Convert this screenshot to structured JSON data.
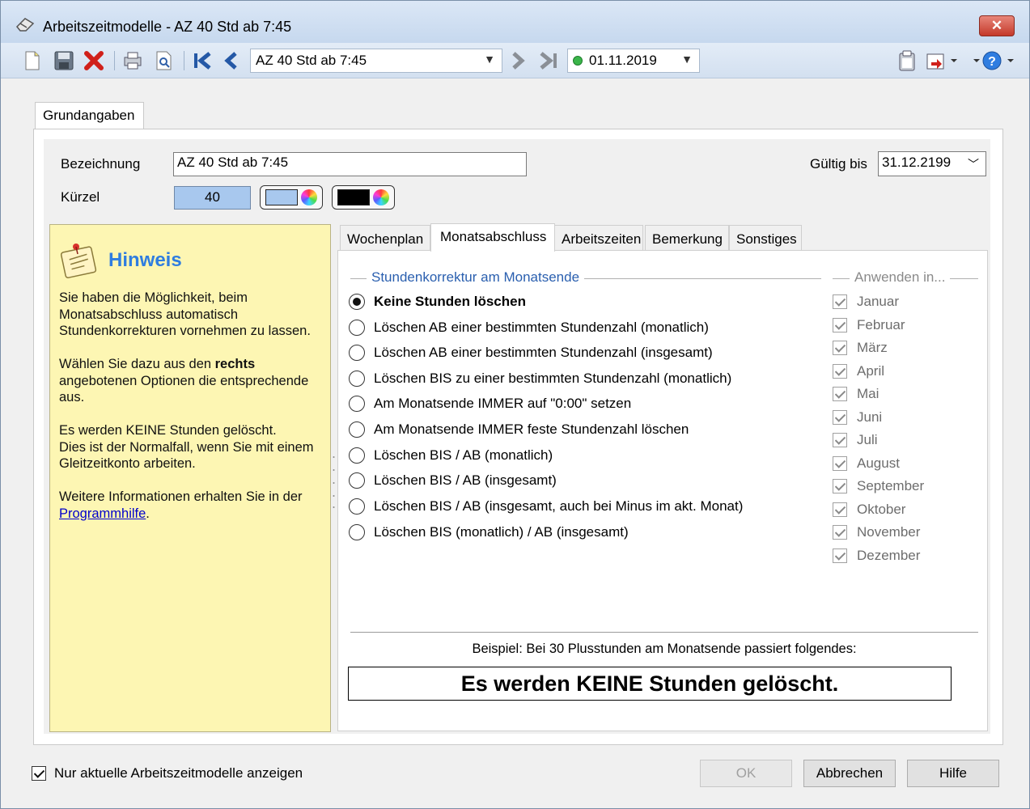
{
  "window": {
    "title": "Arbeitszeitmodelle - AZ 40 Std ab 7:45",
    "close_label": "✕"
  },
  "toolbar": {
    "model_combo_value": "AZ 40 Std ab 7:45",
    "date_combo_value": "01.11.2019",
    "icons": [
      "new-icon",
      "save-icon",
      "delete-icon",
      "print-icon",
      "print-preview-icon",
      "first-record-icon",
      "previous-record-icon",
      "next-record-icon",
      "last-record-icon",
      "clipboard-icon",
      "export-icon",
      "help-icon"
    ]
  },
  "tabs": {
    "main": "Grundangaben"
  },
  "form": {
    "bezeichnung_label": "Bezeichnung",
    "bezeichnung_value": "AZ 40 Std ab 7:45",
    "kuerzel_label": "Kürzel",
    "kuerzel_value": "40",
    "gueltig_bis_label": "Gültig bis",
    "gueltig_bis_value": "31.12.2199",
    "colors": {
      "kuerzel_bg": "#a8c8ee",
      "fg_swatch": "#000000"
    }
  },
  "hint": {
    "title": "Hinweis",
    "p1": "Sie haben die Möglichkeit, beim Monatsabschluss automatisch Stundenkorrekturen vornehmen zu lassen.",
    "p2_a": "Wählen Sie dazu aus den ",
    "p2_bold": "rechts",
    "p2_b": " angebotenen Optionen die entsprechende aus.",
    "p3_line1": "Es werden KEINE Stunden gelöscht.",
    "p3_line2": "Dies ist der Normalfall, wenn Sie mit einem Gleitzeitkonto arbeiten.",
    "p4": "Weitere Informationen erhalten Sie in der ",
    "p4_link": "Programmhilfe",
    "p4_end": "."
  },
  "subtabs": [
    "Wochenplan",
    "Monatsabschluss",
    "Arbeitszeiten",
    "Bemerkung",
    "Sonstiges"
  ],
  "stundenkorrektur": {
    "group_title": "Stundenkorrektur am Monatsende",
    "options": [
      "Keine Stunden löschen",
      "Löschen AB einer bestimmten Stundenzahl (monatlich)",
      "Löschen AB einer bestimmten Stundenzahl (insgesamt)",
      "Löschen BIS zu einer bestimmten Stundenzahl (monatlich)",
      "Am Monatsende IMMER auf \"0:00\" setzen",
      "Am Monatsende IMMER feste Stundenzahl löschen",
      "Löschen BIS / AB (monatlich)",
      "Löschen BIS / AB (insgesamt)",
      "Löschen BIS / AB (insgesamt, auch bei Minus im akt. Monat)",
      "Löschen BIS (monatlich) / AB (insgesamt)"
    ],
    "selected_index": 0
  },
  "anwenden": {
    "group_title": "Anwenden in...",
    "months": [
      "Januar",
      "Februar",
      "März",
      "April",
      "Mai",
      "Juni",
      "Juli",
      "August",
      "September",
      "Oktober",
      "November",
      "Dezember"
    ]
  },
  "example": {
    "label": "Beispiel: Bei 30 Plusstunden am Monatsende passiert folgendes:",
    "result": "Es werden KEINE Stunden gelöscht."
  },
  "footer": {
    "only_current_label": "Nur aktuelle Arbeitszeitmodelle anzeigen",
    "ok_label": "OK",
    "cancel_label": "Abbrechen",
    "help_label": "Hilfe"
  }
}
